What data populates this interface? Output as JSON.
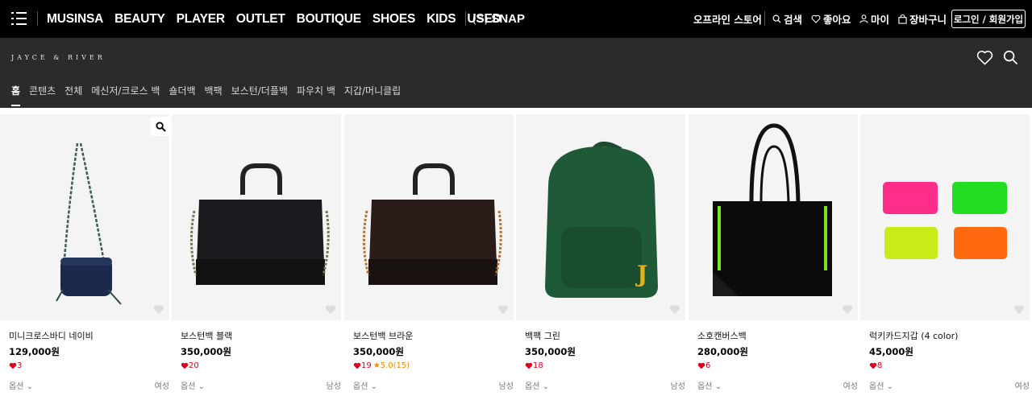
{
  "topnav": {
    "brands": [
      "MUSINSA",
      "BEAUTY",
      "PLAYER",
      "OUTLET",
      "BOUTIQUE",
      "SHOES",
      "KIDS",
      "USED"
    ],
    "snap_mark": "(S)",
    "snap_label": "SNAP",
    "offline_store": "오프라인 스토어",
    "search": "검색",
    "likes": "좋아요",
    "my": "마이",
    "cart": "장바구니",
    "login": "로그인 / 회원가입"
  },
  "store": {
    "logo": "JAYCE & RIVER",
    "categories": [
      "홈",
      "콘텐츠",
      "전체",
      "메신저/크로스 백",
      "숄더백",
      "백팩",
      "보스턴/더플백",
      "파우치 백",
      "지갑/머니클립"
    ],
    "active_category": "홈"
  },
  "products": [
    {
      "name": "미니크로스바디 네이비",
      "price": "129,000원",
      "likes": "3",
      "rating": "",
      "option": "옵션",
      "gender": "여성"
    },
    {
      "name": "보스턴백 블랙",
      "price": "350,000원",
      "likes": "20",
      "rating": "",
      "option": "옵션",
      "gender": "남성"
    },
    {
      "name": "보스턴백 브라운",
      "price": "350,000원",
      "likes": "19",
      "rating": "5.0(15)",
      "option": "옵션",
      "gender": "남성"
    },
    {
      "name": "백팩 그린",
      "price": "350,000원",
      "likes": "18",
      "rating": "",
      "option": "옵션",
      "gender": "남성"
    },
    {
      "name": "소호캔버스백",
      "price": "280,000원",
      "likes": "6",
      "rating": "",
      "option": "옵션",
      "gender": "여성"
    },
    {
      "name": "럭키카드지갑 (4 color)",
      "price": "45,000원",
      "likes": "8",
      "rating": "",
      "option": "옵션",
      "gender": "여성"
    }
  ],
  "colors": {
    "topnav_bg": "#000000",
    "store_bg": "#2b2b2b",
    "like_red": "#e0001b",
    "rating_orange": "#f08c00"
  }
}
